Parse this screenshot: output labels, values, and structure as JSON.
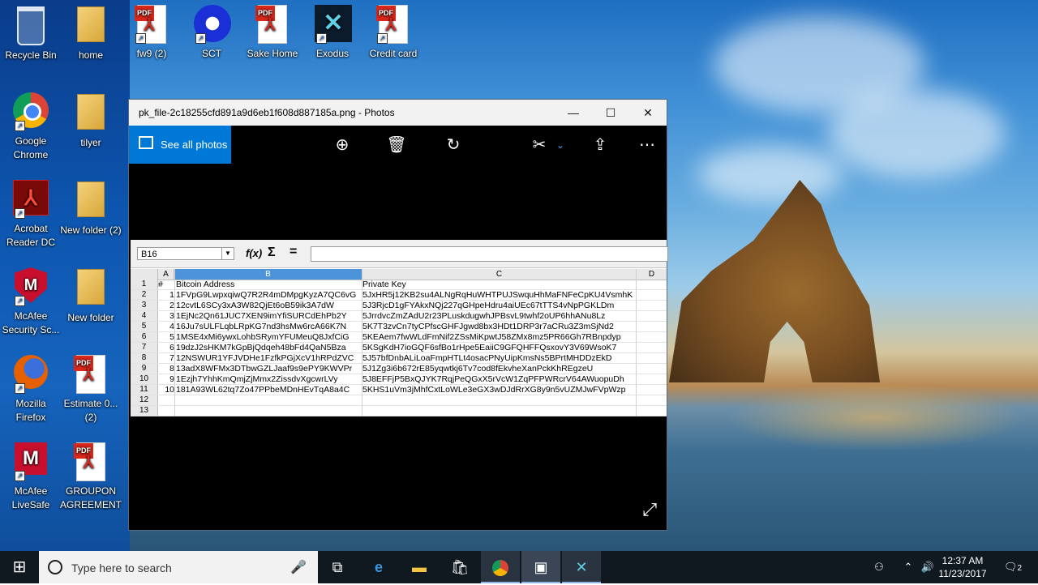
{
  "desktop": {
    "icons": [
      {
        "label": "Recycle Bin"
      },
      {
        "label": "home"
      },
      {
        "label": "fw9 (2)"
      },
      {
        "label": "SCT"
      },
      {
        "label": "Sake Home"
      },
      {
        "label": "Exodus"
      },
      {
        "label": "Credit card"
      },
      {
        "label": "Google Chrome"
      },
      {
        "label": "tilyer"
      },
      {
        "label": "Acrobat Reader DC"
      },
      {
        "label": "New folder (2)"
      },
      {
        "label": "McAfee Security Sc..."
      },
      {
        "label": "New folder"
      },
      {
        "label": "Mozilla Firefox"
      },
      {
        "label": "Estimate 0... (2)"
      },
      {
        "label": "McAfee LiveSafe"
      },
      {
        "label": "GROUPON AGREEMENT"
      }
    ],
    "pdf_tag": "PDF"
  },
  "window": {
    "title": "pk_file-2c18255cfd891a9d6eb1f608d887185a.png - Photos",
    "see_all_photos": "See all photos",
    "controls": {
      "minimize": "—",
      "maximize": "☐",
      "close": "✕"
    }
  },
  "sheet": {
    "name_box": "B16",
    "columns": [
      "A",
      "B",
      "C",
      "D"
    ],
    "header": {
      "a": "#",
      "b": "Bitcoin Address",
      "c": "Private Key"
    },
    "rows": [
      {
        "n": "1",
        "a": "1",
        "b": "1FVpG9LwpxqiwQ7R2R4mDMpgKyzA7QC6vG",
        "c": "5JxHR5j12KB2su4ALNgRqHuWHTPUJSwquHhMaFNFeCpKU4VsmhK"
      },
      {
        "n": "2",
        "a": "2",
        "b": "12cvtL6SCy3xA3W82QjEt6oB59ik3A7dW",
        "c": "5J3RjcD1gFYAkxNQj227qGHpeHdru4aiUEc67tTTS4vNpPGKLDm"
      },
      {
        "n": "3",
        "a": "3",
        "b": "1EjNc2Qn61JUC7XEN9imYfiSURCdEhPb2Y",
        "c": "5JrrdvcZmZAdU2r23PLuskdugwhJPBsvL9twhf2oUP6hhANu8Lz"
      },
      {
        "n": "4",
        "a": "4",
        "b": "16Ju7sULFLqbLRpKG7nd3hsMw6rcA66K7N",
        "c": "5K7T3zvCn7tyCPfscGHFJgwd8bx3HDt1DRP3r7aCRu3Z3mSjNd2"
      },
      {
        "n": "5",
        "a": "5",
        "b": "1MSE4xMi6ywxLohbSRymYFUMeuQ8JxfCiG",
        "c": "5KEAem7fwWLdFmNif2ZSsMiKpwtJ58ZMx8mz5PR66Gh7RBnpdyp"
      },
      {
        "n": "6",
        "a": "6",
        "b": "19dzJ2sHKM7kGpBjQdqeh48bFd4QaN5Bza",
        "c": "5KSgKdH7ioGQF6sfBo1rHpe5EaiiC9GFQHFFQsxovY3V69WsoK7"
      },
      {
        "n": "7",
        "a": "7",
        "b": "12NSWUR1YFJVDHe1FzfkPGjXcV1hRPdZVC",
        "c": "5J57bfDnbALiLoaFmpHTLt4osacPNyUipKmsNs5BPrtMHDDzEkD"
      },
      {
        "n": "8",
        "a": "8",
        "b": "13adX8WFMx3DTbwGZLJaaf9s9ePY9KWVPr",
        "c": "5J1Zg3i6b672rE85yqwtkj6Tv7cod8fEkvheXanPckKhREgzeU"
      },
      {
        "n": "9",
        "a": "9",
        "b": "1Ezjh7YhhKmQmjZjMmx2ZissdvXgcwrLVy",
        "c": "5J8EFFjP5BxQJYK7RqjPeQGxX5rVcW1ZqPFPWRcrV64AWuopuDh"
      },
      {
        "n": "10",
        "a": "10",
        "b": "181A93WL62tq7Zo47PPbeMDnHEvTqA8a4C",
        "c": "5KHS1uVm3jMhfCxtLoWLe3eGX3wDJdRrXG8y9n5vUZMJwFVpWzp"
      },
      {
        "n": "11",
        "a": "",
        "b": "",
        "c": ""
      },
      {
        "n": "12",
        "a": "",
        "b": "",
        "c": ""
      }
    ]
  },
  "taskbar": {
    "search_placeholder": "Type here to search",
    "time": "12:37 AM",
    "date": "11/23/2017",
    "notification_count": "2"
  }
}
